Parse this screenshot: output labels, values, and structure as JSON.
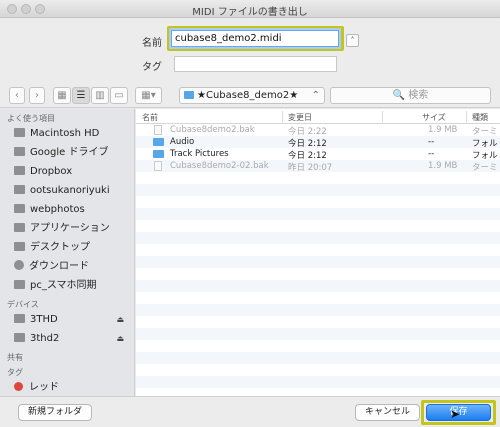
{
  "window": {
    "title": "MIDI ファイルの書き出し"
  },
  "form": {
    "name_label": "名前",
    "name_value": "cubase8_demo2.midi",
    "tag_label": "タグ",
    "expand_icon": "chevron-up-icon"
  },
  "toolbar": {
    "back_icon": "‹",
    "forward_icon": "›",
    "location": "★Cubase8_demo2★",
    "search_placeholder": "🔍 検索"
  },
  "sidebar": {
    "favorites_header": "よく使う項目",
    "favorites": [
      {
        "label": "Macintosh HD"
      },
      {
        "label": "Google ドライブ"
      },
      {
        "label": "Dropbox"
      },
      {
        "label": "ootsukanoriyuki"
      },
      {
        "label": "webphotos"
      },
      {
        "label": "アプリケーション"
      },
      {
        "label": "デスクトップ"
      },
      {
        "label": "ダウンロード"
      },
      {
        "label": "pc_スマホ同期"
      }
    ],
    "devices_header": "デバイス",
    "devices": [
      {
        "label": "3THD",
        "eject": "⏏"
      },
      {
        "label": "3thd2",
        "eject": "⏏"
      }
    ],
    "shared_header": "共有",
    "tags_header": "タグ",
    "tags": [
      {
        "label": "レッド",
        "color": "#e0473c"
      }
    ]
  },
  "file_list": {
    "columns": {
      "name": "名前",
      "modified": "変更日",
      "size": "サイズ",
      "kind": "種類"
    },
    "rows": [
      {
        "name": "Cubase8demo2.bak",
        "modified": "今日 2:22",
        "size": "1.9 MB",
        "kind": "ターミ",
        "type": "file",
        "dim": true
      },
      {
        "name": "Audio",
        "modified": "今日 2:12",
        "size": "--",
        "kind": "フォル",
        "type": "folder",
        "dim": false
      },
      {
        "name": "Track Pictures",
        "modified": "今日 2:12",
        "size": "--",
        "kind": "フォル",
        "type": "folder",
        "dim": false
      },
      {
        "name": "Cubase8demo2-02.bak",
        "modified": "昨日 20:07",
        "size": "1.9 MB",
        "kind": "ターミ",
        "type": "file",
        "dim": true
      }
    ]
  },
  "buttons": {
    "new_folder": "新規フォルダ",
    "cancel": "キャンセル",
    "save": "保存"
  }
}
